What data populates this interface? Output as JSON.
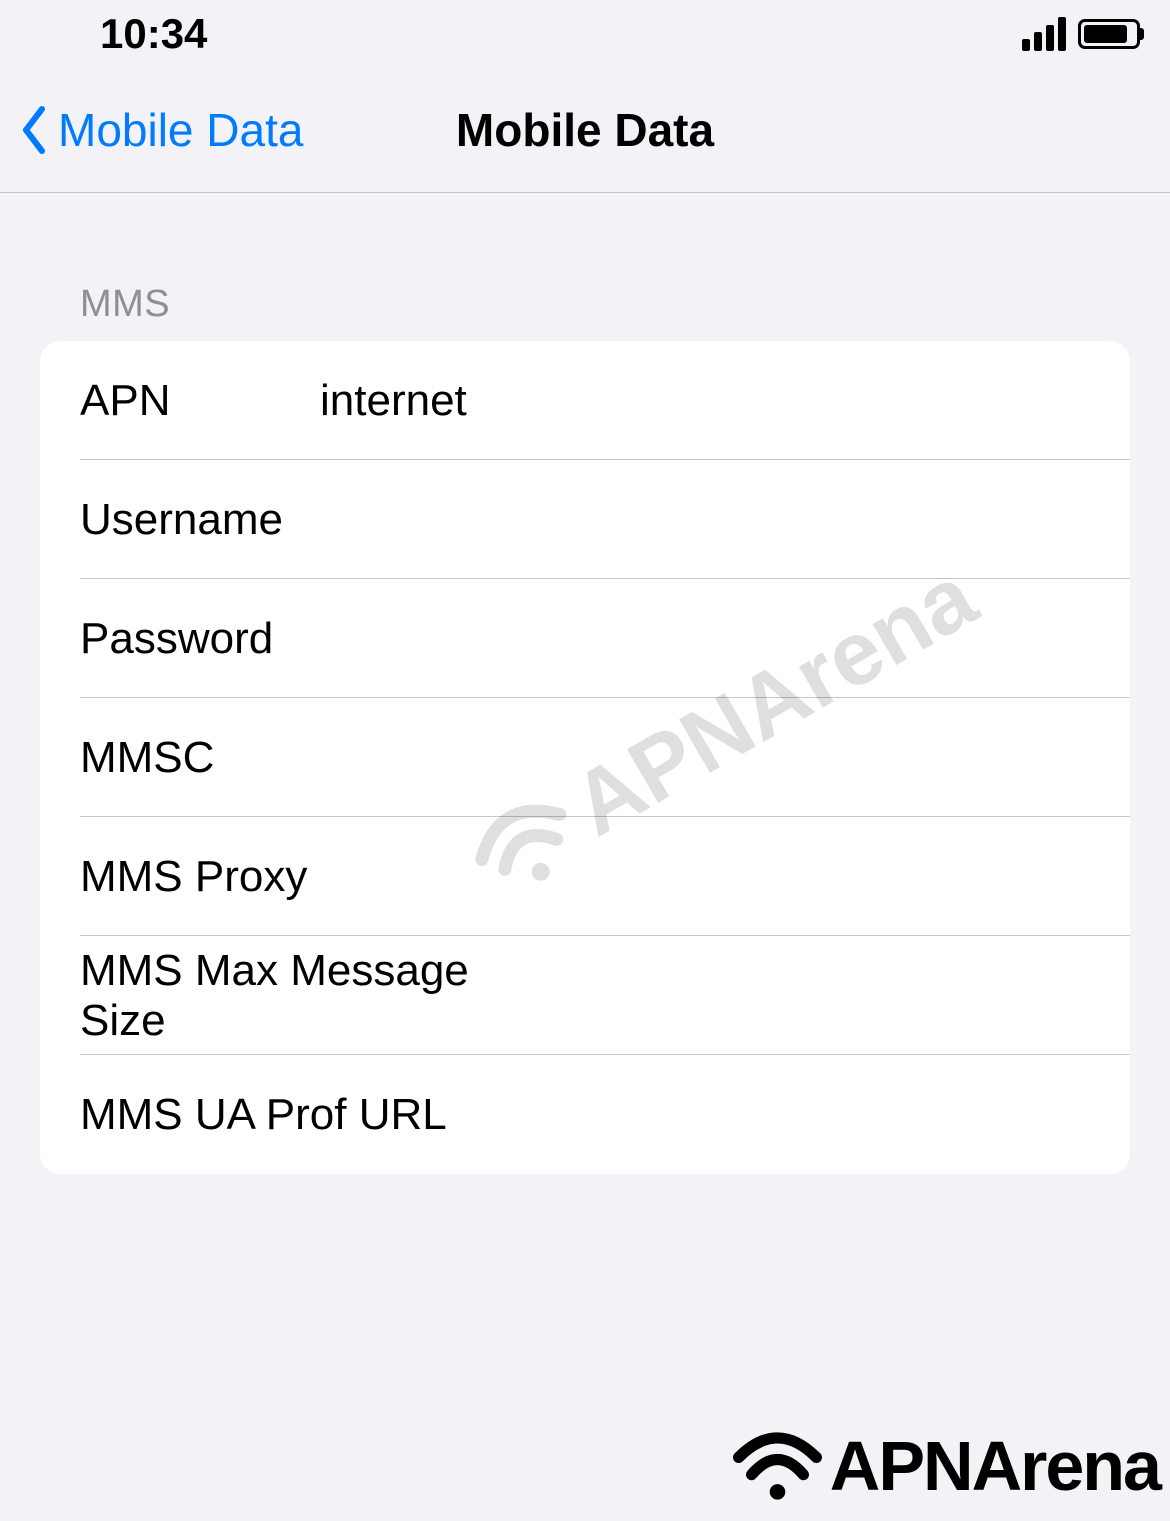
{
  "status_bar": {
    "time": "10:34"
  },
  "nav": {
    "back_label": "Mobile Data",
    "title": "Mobile Data"
  },
  "section": {
    "header": "MMS"
  },
  "fields": {
    "apn": {
      "label": "APN",
      "value": "internet"
    },
    "username": {
      "label": "Username",
      "value": ""
    },
    "password": {
      "label": "Password",
      "value": ""
    },
    "mmsc": {
      "label": "MMSC",
      "value": ""
    },
    "mms_proxy": {
      "label": "MMS Proxy",
      "value": ""
    },
    "mms_max_size": {
      "label": "MMS Max Message Size",
      "value": ""
    },
    "mms_ua_prof": {
      "label": "MMS UA Prof URL",
      "value": ""
    }
  },
  "watermark": {
    "text": "APNArena"
  }
}
